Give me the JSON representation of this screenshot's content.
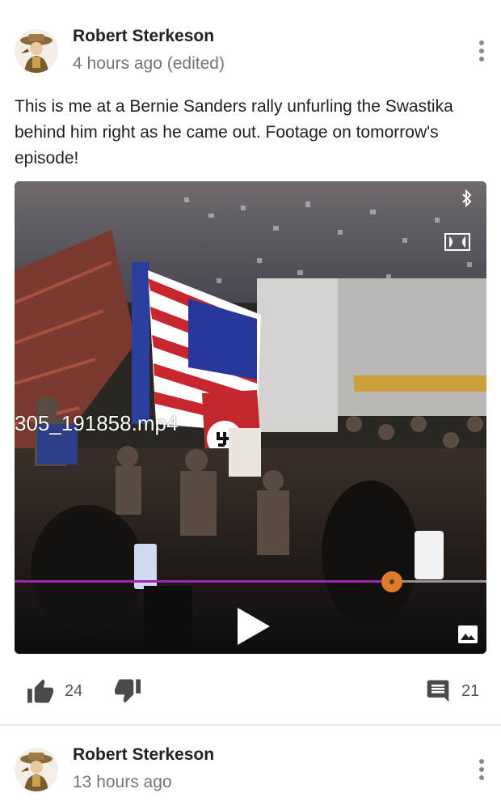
{
  "posts": [
    {
      "author": "Robert Sterkeson",
      "time": "4 hours ago (edited)",
      "text": "This is me at a Bernie Sanders rally unfurling the Swastika behind him right as he came out. Footage on tomorrow's episode!",
      "video": {
        "filename": "305_191858.mp4",
        "progress": 0.8
      },
      "likes": "24",
      "comments": "21"
    },
    {
      "author": "Robert Sterkeson",
      "time": "13 hours ago"
    }
  ],
  "colors": {
    "progress_fill": "#9c27b0",
    "progress_thumb": "#e07b2b",
    "icon_gray": "#4a4a4a"
  },
  "icons": {
    "like": "thumb-up-icon",
    "dislike": "thumb-down-icon",
    "comment": "comment-icon",
    "more": "more-vert-icon",
    "play": "play-icon",
    "gallery": "image-icon"
  }
}
